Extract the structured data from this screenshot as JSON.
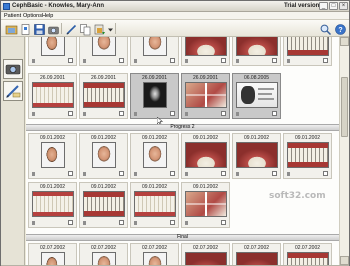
{
  "window": {
    "title": "CephBasic - Knowles, Mary-Ann",
    "trial_label": "Trial version",
    "minimize": "_",
    "maximize": "□",
    "close": "×"
  },
  "menu": [
    "Patient",
    "Options",
    "Help"
  ],
  "sections": {
    "progress2": "Progress 2",
    "final": "Final"
  },
  "rows": [
    {
      "dates": [
        "",
        "",
        "",
        "",
        "",
        "",
        ""
      ]
    },
    {
      "dates": [
        "26.09.2001",
        "26.09.2001",
        "26.09.2001",
        "26.09.2001",
        "06.08.2005"
      ]
    },
    {
      "dates": [
        "09.01.2002",
        "09.01.2002",
        "09.01.2002",
        "09.01.2002",
        "09.01.2002",
        "09.01.2002"
      ]
    },
    {
      "dates": [
        "09.01.2002",
        "09.01.2002",
        "09.01.2002",
        "09.01.2002"
      ]
    },
    {
      "dates": [
        "02.07.2002",
        "02.07.2002",
        "02.07.2002",
        "02.07.2002",
        "02.07.2002",
        "02.07.2002"
      ]
    }
  ],
  "watermark": "soft32.com"
}
